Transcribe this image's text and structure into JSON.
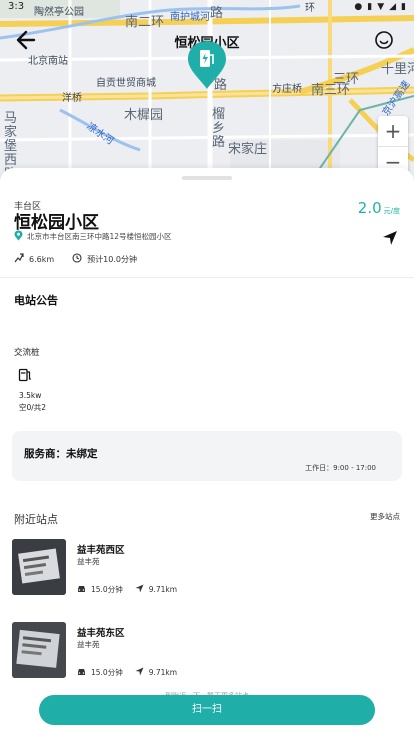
{
  "status_bar": {
    "time": "3:3"
  },
  "map": {
    "title": "恒松园小区",
    "labels": {
      "park": "陶然亭公园",
      "ring2": "南二环",
      "moat": "南护城河",
      "road": "路",
      "south_station": "北京南站",
      "store": "自贡世贸商城",
      "yangqiao": "洋桥",
      "fangzhuang": "方庄桥",
      "ring2_right": "南三环",
      "muxiyuan": "木樨园",
      "shiliuhe": "十里河",
      "liangshui": "凉水河",
      "jiajing": "马家堡西路",
      "liuyuan": "榴乡路",
      "songjiazhuang": "宋家庄",
      "ring2_top_right": "环",
      "sanhuan": "三环",
      "road2": "路",
      "jingjin": "京沪高速"
    },
    "zoom_in": "+",
    "zoom_out": "−",
    "icons": {
      "back": "back-arrow-icon",
      "face": "smiley-icon",
      "pin": "charging-pin-icon"
    }
  },
  "station": {
    "district": "丰台区",
    "name": "恒松园小区",
    "price": "2.0",
    "price_unit": "元/度",
    "address": "北京市丰台区南三环中路12号楼恒松园小区",
    "distance": "6.6km",
    "eta": "预计10.0分钟"
  },
  "notice_title": "电站公告",
  "pile": {
    "section_title": "交流桩",
    "power": "3.5kw",
    "count": "空0/共2"
  },
  "provider": {
    "label": "服务商：未绑定",
    "hours": "工作日：9:00 - 17:00"
  },
  "nearby": {
    "title": "附近站点",
    "more": "更多站点",
    "items": [
      {
        "name": "益丰苑西区",
        "sub": "益丰苑",
        "time": "15.0分钟",
        "distance": "9.71km"
      },
      {
        "name": "益丰苑东区",
        "sub": "益丰苑",
        "time": "15.0分钟",
        "distance": "9.71km"
      }
    ]
  },
  "footer_note": "到附近一下，暂无更多站点",
  "scan_button": "扫一扫",
  "colors": {
    "accent": "#1faea8",
    "price": "#20b2aa"
  }
}
